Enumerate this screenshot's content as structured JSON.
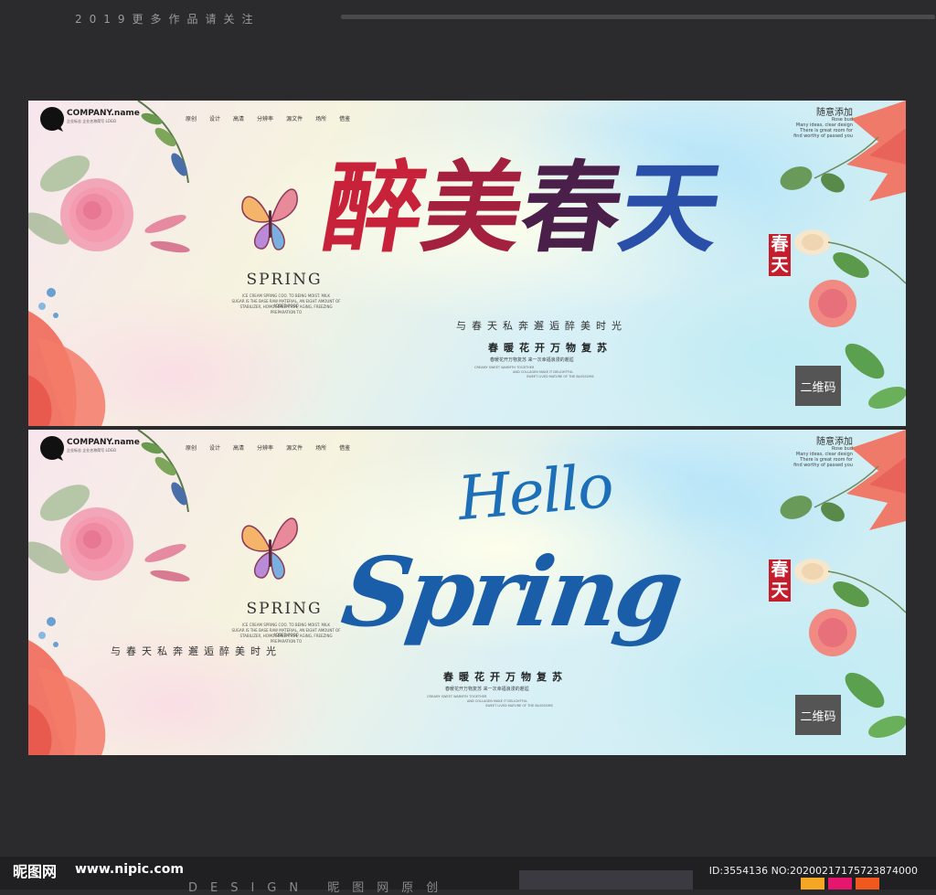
{
  "header": {
    "caption": "2019更多作品请关注"
  },
  "banner_common": {
    "company": "COMPANY.name",
    "company_sub": "企业标志 企业名称简写 LOGO",
    "nav": [
      "原创",
      "设计",
      "高清",
      "分辨率",
      "源文件",
      "场所",
      "借鉴"
    ],
    "top_right_title": "随意添加",
    "top_right_lines": [
      "Rose bud",
      "Many ideas, clear design",
      "There is great room for",
      "find worthy of passed you"
    ],
    "spring_word": "SPRING",
    "seal": [
      "春",
      "天"
    ],
    "qr_label": "二维码",
    "en_lines": [
      "ICE CREAM SPRING COO. TO BEING MOIST. MILK",
      "SUGAR IS THE BASE RAW MATERIAL, AN EIGHT AMOUNT OF ADDED FOOD",
      "STABILIZER, HOMOGENIZATION, AGING, FREEZING",
      "PREPARATION TO"
    ],
    "tiny_lines": [
      "CREAMY SWEET WARMTH TOGETHER",
      "AND COLLAGEN MAKE IT DELIGHTFUL",
      "SWEET LIVED MATURE OF THE BLOSSOMS"
    ]
  },
  "banner1": {
    "title_chars": [
      "醉",
      "美",
      "春",
      "天"
    ],
    "title_colors": [
      "#c8213a",
      "#a3203e",
      "#4a1f4a",
      "#2a4fa8"
    ],
    "tagline": "与春天私奔邂逅醉美时光",
    "bold_line": "春暖花开万物复苏",
    "small_line": "春暖花开万物复苏 来一次幸福浪漫的邂逅"
  },
  "banner2": {
    "hello": "Hello",
    "spring_script": "Spring",
    "tagline": "与春天私奔邂逅醉美时光",
    "bold_line": "春暖花开万物复苏",
    "small_line": "春暖花开万物复苏 来一次幸福浪漫的邂逅"
  },
  "footer": {
    "logo": "昵图网",
    "url": "www.nipic.com",
    "id_line": "ID:3554136 NO:20200217175723874000",
    "design": "DESIGN 昵图网原创"
  },
  "colors": {
    "background": "#2b2b2d",
    "seal": "#c41d2c",
    "script_blue": "#1a5da8"
  }
}
